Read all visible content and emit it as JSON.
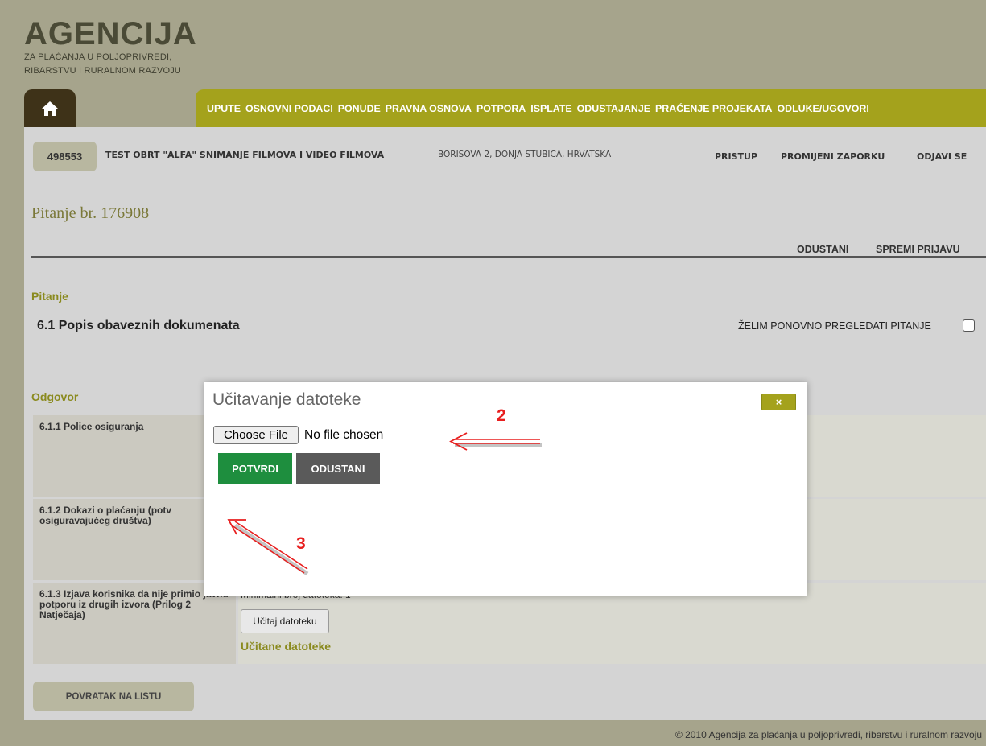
{
  "logo": {
    "title": "AGENCIJA",
    "line1": "ZA PLAĆANJA U POLJOPRIVREDI,",
    "line2": "RIBARSTVU I RURALNOM RAZVOJU"
  },
  "nav": {
    "home_icon": "home-icon",
    "items": [
      {
        "label": "UPUTE"
      },
      {
        "label": "OSNOVNI PODACI"
      },
      {
        "label": "PONUDE"
      },
      {
        "label": "PRAVNA OSNOVA"
      },
      {
        "label": "POTPORA"
      },
      {
        "label": "ISPLATE"
      },
      {
        "label": "ODUSTAJANJE"
      },
      {
        "label": "PRAĆENJE PROJEKATA"
      },
      {
        "label": "ODLUKE/UGOVORI"
      }
    ]
  },
  "user": {
    "id": "498553",
    "name": "TEST OBRT \"ALFA\" SNIMANJE FILMOVA I VIDEO FILMOVA",
    "address": "BORISOVA 2, DONJA STUBICA, HRVATSKA",
    "links": {
      "access": "PRISTUP",
      "change_password": "PROMIJENI ZAPORKU",
      "logout": "ODJAVI SE"
    }
  },
  "question": {
    "title": "Pitanje br. 176908",
    "actions": {
      "cancel": "ODUSTANI",
      "save": "SPREMI PRIJAVU"
    },
    "section_label": "Pitanje",
    "text": "6.1 Popis obaveznih dokumenata",
    "review_label": "ŽELIM PONOVNO PREGLEDATI PITANJE",
    "review_checked": false
  },
  "answer": {
    "section_label": "Odgovor",
    "rows": [
      {
        "label": "6.1.1 Police osiguranja"
      },
      {
        "label": "6.1.2 Dokazi o plaćanju (potv osiguravajućeg društva)"
      },
      {
        "label": "6.1.3 Izjava korisnika da nije primio javnu potporu iz drugih izvora (Prilog 2 Natječaja)"
      }
    ],
    "min_files": "Minimalni broj datoteka: 1",
    "upload_button": "Učitaj datoteku",
    "uploaded_label": "Učitane datoteke"
  },
  "back_button": "POVRATAK NA LISTU",
  "footer": "© 2010 Agencija za plaćanja u poljoprivredi, ribarstvu i ruralnom razvoju",
  "modal": {
    "title": "Učitavanje datoteke",
    "close_label": "×",
    "choose_file": "Choose File",
    "no_file": "No file chosen",
    "confirm": "POTVRDI",
    "cancel": "ODUSTANI"
  },
  "annotations": {
    "label_2": "2",
    "label_3": "3",
    "color": "#e81e1e"
  },
  "colors": {
    "nav": "#a4a21c",
    "home_tab": "#3e3218",
    "confirm": "#1e8e3e",
    "cancel": "#5a5a5a",
    "accent_text": "#8a8a1e"
  }
}
